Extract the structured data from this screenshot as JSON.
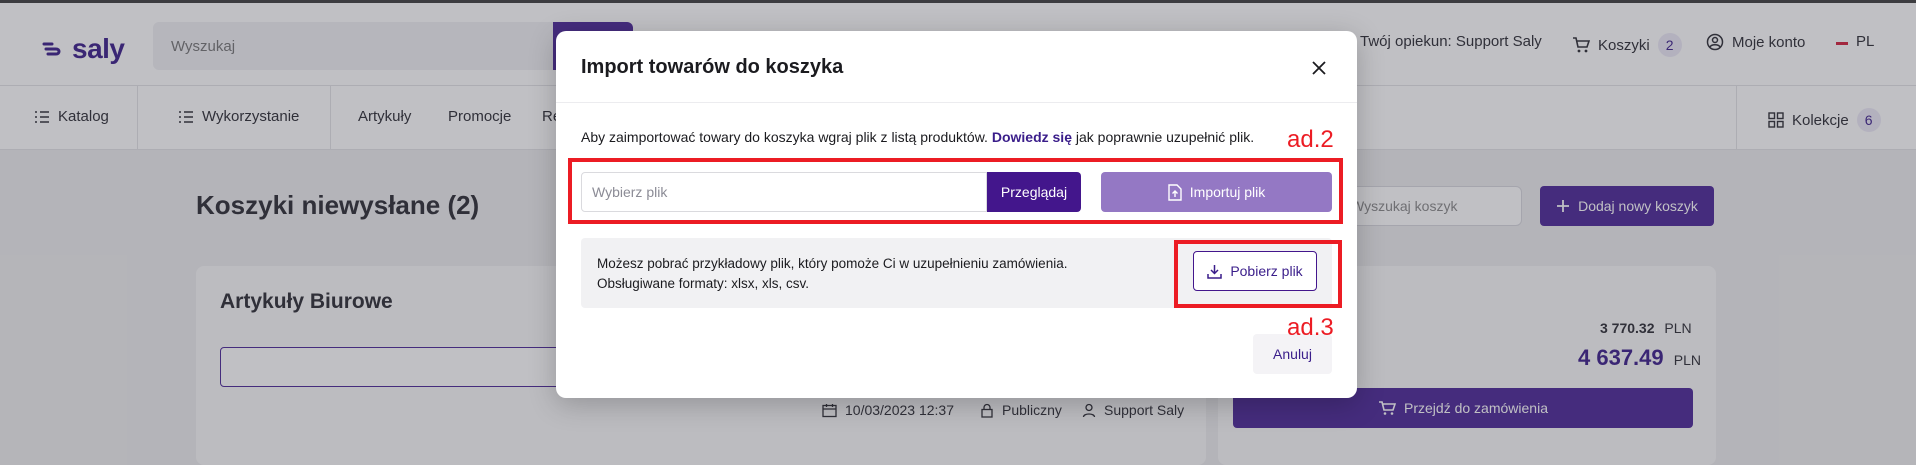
{
  "header": {
    "logo_text": "saly",
    "search_placeholder": "Wyszukaj",
    "advisor": "Twój opiekun: Support Saly",
    "carts_label": "Koszyki",
    "carts_count": "2",
    "account_label": "Moje konto",
    "language": "PL"
  },
  "nav": {
    "catalog": "Katalog",
    "usage": "Wykorzystanie",
    "articles": "Artykuły",
    "promotions": "Promocje",
    "truncated": "Re",
    "collections": "Kolekcje",
    "collections_count": "6"
  },
  "page": {
    "title": "Koszyki niewysłane (2)",
    "cart_search_placeholder": "Wyszukaj koszyk",
    "add_cart_label": "Dodaj nowy koszyk",
    "card_title": "Artykuły Biurowe",
    "date": "10/03/2023 12:37",
    "visibility": "Publiczny",
    "owner": "Support Saly",
    "net_amount": "3 770.32",
    "gross_amount": "4 637.49",
    "currency": "PLN",
    "go_to_orders": "Przejdź do zamówienia"
  },
  "modal": {
    "title": "Import towarów do koszyka",
    "instruction_before": "Aby zaimportować towary do koszyka wgraj plik z listą produktów. ",
    "instruction_link": "Dowiedz się",
    "instruction_after": " jak poprawnie uzupełnić plik.",
    "file_placeholder": "Wybierz plik",
    "browse_label": "Przeglądaj",
    "import_label": "Importuj plik",
    "info_line1": "Możesz pobrać przykładowy plik, który pomoże Ci w uzupełnieniu zamówienia.",
    "info_line2": "Obsługiwane formaty: xlsx, xls, csv.",
    "download_label": "Pobierz plik",
    "cancel_label": "Anuluj"
  },
  "annotations": {
    "label_2": "ad.2",
    "label_3": "ad.3",
    "color": "#ec1c24"
  },
  "colors": {
    "brand_primary": "#43168c",
    "brand_light": "#9478c4",
    "annotation_red": "#ec1c24"
  }
}
